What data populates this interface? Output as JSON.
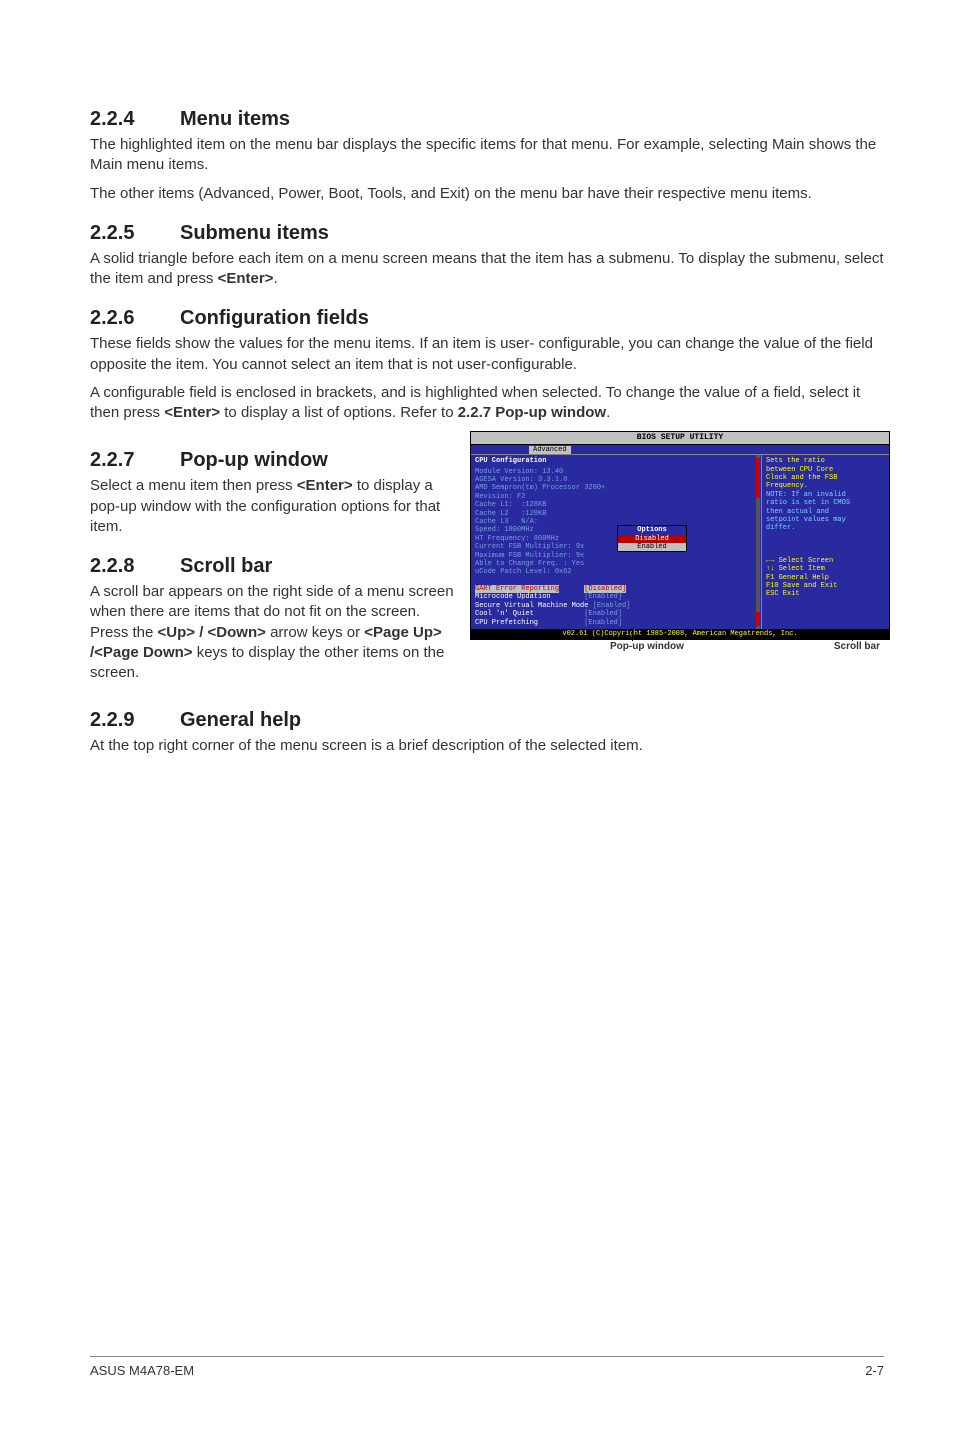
{
  "sections": {
    "s224": {
      "num": "2.2.4",
      "title": "Menu items",
      "p1": "The highlighted item on the menu bar displays the specific items for that menu. For example, selecting Main shows the Main menu items.",
      "p2": "The other items (Advanced, Power, Boot, Tools, and Exit) on the menu bar have their respective menu items."
    },
    "s225": {
      "num": "2.2.5",
      "title": "Submenu items",
      "p1a": "A solid triangle before each item on a menu screen means that the item has a submenu. To display the submenu, select the item and press ",
      "p1key": "<Enter>",
      "p1b": "."
    },
    "s226": {
      "num": "2.2.6",
      "title": "Configuration fields",
      "p1": "These fields show the values for the menu items. If an item is user- configurable, you can change the value of the field opposite the item. You cannot select an item that is not user-configurable.",
      "p2a": "A configurable field is enclosed in brackets, and is highlighted when selected. To change the value of a field, select it then press ",
      "p2key": "<Enter>",
      "p2b": " to display a list of options. Refer to ",
      "p2ref": "2.2.7 Pop-up window",
      "p2c": "."
    },
    "s227": {
      "num": "2.2.7",
      "title": "Pop-up window",
      "p1a": "Select a menu item then press ",
      "p1key": "<Enter>",
      "p1b": " to display a pop-up window with the configuration options for that item."
    },
    "s228": {
      "num": "2.2.8",
      "title": "Scroll bar",
      "p1a": "A scroll bar appears on the right side of a menu screen when there are items that do not fit on the screen. Press the ",
      "k1": "<Up> / <Down>",
      "p1b": " arrow keys or ",
      "k2": "<Page Up> /<Page Down>",
      "p1c": " keys to display the other items on the screen."
    },
    "s229": {
      "num": "2.2.9",
      "title": "General help",
      "p1": "At the top right corner of the menu screen is a brief description of the selected item."
    }
  },
  "bios": {
    "title": "BIOS SETUP UTILITY",
    "tab": "Advanced",
    "left_header": "CPU Configuration",
    "lines": [
      "Module Version: 13.40",
      "AGESA Version: 3.3.1.0",
      "",
      "AMD Sempron(tm) Processor 3200+",
      "Revision: F2",
      "Cache L1:  :128KB",
      "Cache L2   :128KB",
      "Cache L3   N/A:",
      "Speed: 1800MHz",
      "HT Frequency: 800MHz",
      "Current FSB Multiplier: 9x",
      "Maximum FSB Multiplier: 9x",
      "Able to Change Freq. : Yes",
      "uCode Patch Level: 0x62"
    ],
    "sel_row": {
      "label": "GART Error Reporting",
      "value": "[Disabled]"
    },
    "rows_hi": [
      {
        "label": "Microcode Updation",
        "value": "[Enabled]"
      },
      {
        "label": "Secure Virtual Machine Mode",
        "value": "[Enabled]"
      },
      {
        "label": "Cool 'n' Quiet",
        "value": "[Enabled]"
      },
      {
        "label": "CPU Prefetching",
        "value": "[Enabled]"
      }
    ],
    "popup": {
      "title": "Options",
      "sel": "Disabled",
      "other": "Enabled"
    },
    "help": [
      "Sets the ratio",
      "between CPU Core",
      "Clock and the FSB",
      "Frequency.",
      "NOTE: If an invalid",
      "ratio is set in CMOS",
      "then actual and",
      "setpoint values may",
      "differ."
    ],
    "nav": [
      "←→   Select Screen",
      "↑↓   Select Item",
      "F1   General Help",
      "F10  Save and Exit",
      "ESC  Exit"
    ],
    "footer": "v02.61 (C)Copyright 1985-2008, American Megatrends, Inc.",
    "callout_popup": "Pop-up window",
    "callout_scroll": "Scroll bar"
  },
  "footer": {
    "left": "ASUS M4A78-EM",
    "right": "2-7"
  }
}
